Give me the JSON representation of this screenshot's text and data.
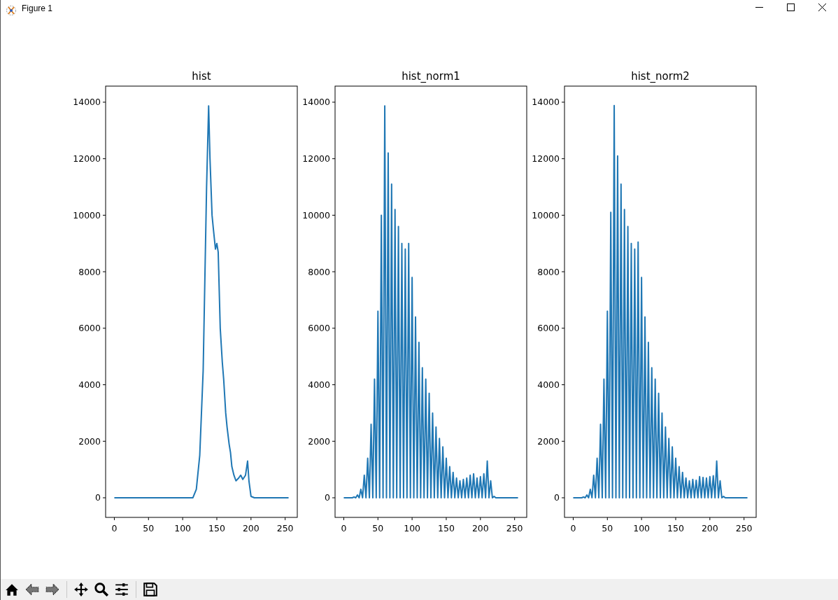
{
  "window": {
    "title": "Figure 1"
  },
  "subplots": [
    {
      "chart_data": {
        "type": "line",
        "title": "hist",
        "x": [
          0,
          115,
          120,
          125,
          130,
          135,
          138,
          140,
          143,
          145,
          148,
          150,
          152,
          155,
          158,
          160,
          163,
          165,
          168,
          170,
          172,
          175,
          178,
          182,
          185,
          188,
          192,
          195,
          197,
          200,
          205,
          255
        ],
        "series": [
          {
            "color": "#1f77b4",
            "values": [
              0,
              0,
              300,
              1500,
              4500,
              11000,
              13870,
              12000,
              10000,
              9500,
              8800,
              9000,
              8700,
              6000,
              4800,
              4200,
              3000,
              2500,
              1900,
              1600,
              1100,
              800,
              600,
              700,
              800,
              650,
              800,
              1300,
              600,
              50,
              0,
              0
            ]
          }
        ],
        "xlim": [
          -12.75,
          267.75
        ],
        "ylim": [
          -694,
          14569
        ],
        "xticks": [
          0,
          50,
          100,
          150,
          200,
          250
        ],
        "yticks": [
          0,
          2000,
          4000,
          6000,
          8000,
          10000,
          12000,
          14000
        ]
      }
    },
    {
      "chart_data": {
        "type": "line",
        "title": "hist_norm1",
        "x": [
          0,
          12.5,
          15,
          17.5,
          20,
          22.5,
          25,
          27.5,
          30,
          32.5,
          35,
          37.5,
          40,
          42.5,
          45,
          47.5,
          50,
          52.5,
          55,
          57.5,
          60,
          62.5,
          65,
          67.5,
          70,
          72.5,
          75,
          77.5,
          80,
          82.5,
          85,
          87.5,
          90,
          92.5,
          95,
          97.5,
          100,
          102.5,
          105,
          107.5,
          110,
          112.5,
          115,
          117.5,
          120,
          122.5,
          125,
          127.5,
          130,
          132.5,
          135,
          137.5,
          140,
          142.5,
          145,
          147.5,
          150,
          152.5,
          155,
          157.5,
          160,
          162.5,
          165,
          167.5,
          170,
          172.5,
          175,
          177.5,
          180,
          182.5,
          185,
          187.5,
          190,
          192.5,
          195,
          197.5,
          200,
          202.5,
          205,
          207.5,
          210,
          212.5,
          215,
          217.5,
          220,
          222.5,
          225,
          227.5,
          255
        ],
        "series": [
          {
            "color": "#1f77b4",
            "values": [
              0,
              0,
              30,
              0,
              100,
              0,
              300,
              0,
              800,
              0,
              1400,
              0,
              2600,
              0,
              4200,
              0,
              6600,
              0,
              10000,
              0,
              13870,
              0,
              12200,
              0,
              11100,
              0,
              10200,
              0,
              9600,
              0,
              9000,
              0,
              8800,
              0,
              9000,
              0,
              7800,
              0,
              6400,
              0,
              5500,
              0,
              4600,
              0,
              4200,
              0,
              3700,
              0,
              3000,
              0,
              2500,
              0,
              2100,
              0,
              1800,
              0,
              1400,
              0,
              1100,
              0,
              900,
              0,
              700,
              0,
              600,
              0,
              650,
              0,
              700,
              0,
              800,
              0,
              850,
              0,
              700,
              0,
              750,
              0,
              850,
              0,
              1300,
              0,
              600,
              0,
              50,
              0,
              0,
              0,
              0
            ]
          }
        ],
        "xlim": [
          -12.75,
          267.75
        ],
        "ylim": [
          -694,
          14569
        ],
        "xticks": [
          0,
          50,
          100,
          150,
          200,
          250
        ],
        "yticks": [
          0,
          2000,
          4000,
          6000,
          8000,
          10000,
          12000,
          14000
        ]
      }
    },
    {
      "chart_data": {
        "type": "line",
        "title": "hist_norm2",
        "x": [
          0,
          12.5,
          15,
          17.5,
          20,
          22.5,
          25,
          27.5,
          30,
          32.5,
          35,
          37.5,
          40,
          42.5,
          45,
          47.5,
          50,
          52.5,
          55,
          57.5,
          60,
          62.5,
          65,
          67.5,
          70,
          72.5,
          75,
          77.5,
          80,
          82.5,
          85,
          87.5,
          90,
          92.5,
          95,
          97.5,
          100,
          102.5,
          105,
          107.5,
          110,
          112.5,
          115,
          117.5,
          120,
          122.5,
          125,
          127.5,
          130,
          132.5,
          135,
          137.5,
          140,
          142.5,
          145,
          147.5,
          150,
          152.5,
          155,
          157.5,
          160,
          162.5,
          165,
          167.5,
          170,
          172.5,
          175,
          177.5,
          180,
          182.5,
          185,
          187.5,
          190,
          192.5,
          195,
          197.5,
          200,
          202.5,
          205,
          207.5,
          210,
          212.5,
          215,
          217.5,
          220,
          222.5,
          225,
          227.5,
          255
        ],
        "series": [
          {
            "color": "#1f77b4",
            "values": [
              0,
              0,
              30,
              0,
              100,
              0,
              300,
              0,
              800,
              0,
              1400,
              0,
              2600,
              0,
              4200,
              0,
              6600,
              0,
              10100,
              0,
              13880,
              0,
              12100,
              0,
              11100,
              0,
              10200,
              0,
              9600,
              0,
              9000,
              0,
              8800,
              0,
              9050,
              0,
              7800,
              0,
              6400,
              0,
              5500,
              0,
              4600,
              0,
              4200,
              0,
              3700,
              0,
              3000,
              0,
              2500,
              0,
              2100,
              0,
              1800,
              0,
              1400,
              0,
              1100,
              0,
              900,
              0,
              700,
              0,
              600,
              0,
              650,
              0,
              620,
              0,
              750,
              0,
              720,
              0,
              700,
              0,
              750,
              0,
              780,
              0,
              1300,
              0,
              600,
              0,
              50,
              0,
              0,
              0,
              0
            ]
          }
        ],
        "xlim": [
          -12.75,
          267.75
        ],
        "ylim": [
          -694,
          14569
        ],
        "xticks": [
          0,
          50,
          100,
          150,
          200,
          250
        ],
        "yticks": [
          0,
          2000,
          4000,
          6000,
          8000,
          10000,
          12000,
          14000
        ]
      }
    }
  ],
  "toolbar": {
    "buttons": [
      {
        "kind": "home"
      },
      {
        "kind": "back"
      },
      {
        "kind": "forward"
      },
      {
        "kind": "separator"
      },
      {
        "kind": "pan"
      },
      {
        "kind": "zoom"
      },
      {
        "kind": "configure"
      },
      {
        "kind": "separator"
      },
      {
        "kind": "save"
      }
    ]
  }
}
